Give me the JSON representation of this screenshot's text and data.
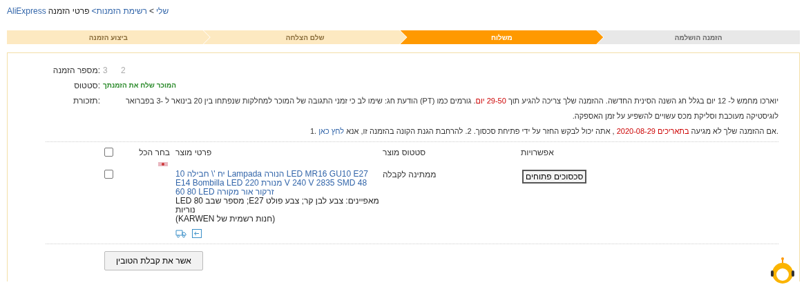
{
  "breadcrumb": [
    {
      "text": "שלי",
      "kind": "link"
    },
    {
      "text": ">",
      "kind": "sep"
    },
    {
      "text": "רשימת הזמנות>",
      "kind": "link"
    },
    {
      "text": "פרטי הזמנה",
      "kind": "current"
    },
    {
      "text": "AliExpress",
      "kind": "link"
    }
  ],
  "steps": [
    {
      "label": "הזמנה הושלמה",
      "done": false,
      "selected": false
    },
    {
      "label": "משלוח",
      "selected": true
    },
    {
      "label": "שלם הצלחה",
      "done": true,
      "selected": false
    },
    {
      "label": "ביצוע הזמנה",
      "done": true,
      "selected": false
    }
  ],
  "order": {
    "number_label": "מספר הזמנה:",
    "number": "3  2",
    "status_label": "סטטוס:",
    "status": "המוכר שלח את הזמנתך",
    "reminder_label": "תזכורת:",
    "reminders": [
      [
        {
          "text": "יוארכו מחמש ל- 12 יום בגלל חג השנה הסינית החדשה. ההזמנה שלך צריכה להגיע תוך ",
          "kind": "plain"
        },
        {
          "text": "29-50 יום",
          "kind": "highlight"
        },
        {
          "text": ". גורמים כמו (PT) הודעת חג: שימו לב כי זמני התגובה של המוכר למחלקות שנפתחו בין 20 בינואר ל -3 בפברואר",
          "kind": "plain"
        }
      ],
      [
        {
          "text": "לוגיסטיקה מעוכבת וסליקת מכס עשויים להשפיע על זמן האספקה.",
          "kind": "plain"
        }
      ],
      [
        {
          "text": ".אם ההזמנה שלך לא מגיעה ",
          "kind": "plain"
        },
        {
          "text": "בתאריכים 2020-08-29",
          "kind": "highlight"
        },
        {
          "text": " , אתה יכול לבקש החזר על ידי פתיחת סכסוך. 2. להרחבת הגנת הקונה בהזמנה זו, אנא ",
          "kind": "plain"
        },
        {
          "text": "לחץ כאן",
          "kind": "link"
        },
        {
          "text": " .1",
          "kind": "plain"
        }
      ]
    ]
  },
  "table": {
    "columns": [
      "אפשרויות",
      "סטטוס מוצר",
      "פרטי מוצר",
      "בחר הכל"
    ],
    "select_all": {
      "checked": false
    },
    "rows": [
      {
        "checked": false,
        "title": [
          "10 יח '\\ חבילה Lampada הנורה LED MR16 GU10 E27",
          "E14 Bombilla LED 220 מנורת V 240 V 2835 SMD 48",
          "60 80 LED זרקור אור מקורה"
        ],
        "attributes": "LED 80 מספר שבב ;E27 מאפיינים: צבע לבן קר; צבע פולט נוריות",
        "store": "(KARWEN חנות רשמית של)",
        "status": "ממתינה לקבלה",
        "action": "סכסוכים פתוחים"
      }
    ]
  },
  "confirm_button": "אשר את קבלת הטובין"
}
